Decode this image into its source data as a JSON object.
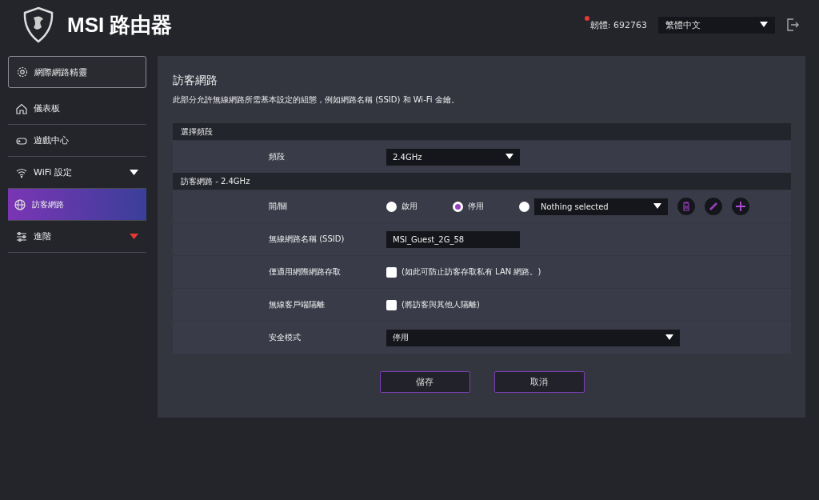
{
  "header": {
    "title": "MSI 路由器",
    "firmware": "韌體: 692763",
    "firmware_alert": true,
    "language": "繁體中文"
  },
  "sidebar": {
    "items": [
      {
        "label": "網際網路精靈",
        "kind": "boxed",
        "selected": false
      },
      {
        "label": "儀表板",
        "kind": "plain",
        "selected": false
      },
      {
        "label": "遊戲中心",
        "kind": "plain",
        "selected": false
      },
      {
        "label": "WiFi 設定",
        "kind": "expand",
        "selected": false,
        "color": "#ffffff"
      },
      {
        "label": "訪客網路",
        "kind": "plain",
        "selected": true
      },
      {
        "label": "進階",
        "kind": "expand",
        "selected": false,
        "color": "#e53935"
      }
    ]
  },
  "page": {
    "title": "訪客網路",
    "description": "此部分允許無線網路所需基本設定的組態，例如網路名稱 (SSID) 和 Wi-Fi 金鑰。",
    "sections": [
      {
        "title": "選擇頻段",
        "rows": [
          {
            "kind": "select",
            "label": "頻段",
            "value": "2.4GHz"
          }
        ]
      },
      {
        "title": "訪客網路 - 2.4GHz",
        "rows": [
          {
            "kind": "radio",
            "label": "開/關",
            "options": [
              {
                "label": "啟用",
                "selected": false
              },
              {
                "label": "停用",
                "selected": true
              },
              {
                "selected": false,
                "schedule": "Nothing selected"
              }
            ]
          },
          {
            "kind": "text",
            "label": "無線網路名稱 (SSID)",
            "value": "MSI_Guest_2G_58"
          },
          {
            "kind": "checkbox",
            "label": "僅適用網際網路存取",
            "checked": false,
            "hint": "(如此可防止訪客存取私有 LAN 網路。)"
          },
          {
            "kind": "checkbox",
            "label": "無線客戶端隔離",
            "checked": false,
            "hint": "(將訪客與其他人隔離)"
          },
          {
            "kind": "wideselect",
            "label": "安全模式",
            "value": "停用"
          }
        ]
      }
    ]
  },
  "buttons": [
    "儲存",
    "取消"
  ]
}
